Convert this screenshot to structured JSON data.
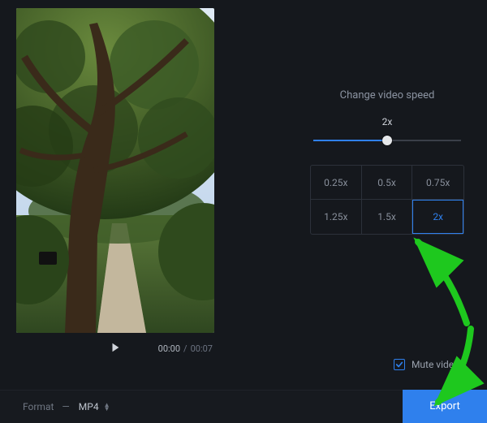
{
  "preview": {
    "current_time": "00:00",
    "duration": "00:07"
  },
  "settings": {
    "title": "Change video speed",
    "current_speed_label": "2x",
    "slider_percent": 50,
    "speeds": [
      "0.25x",
      "0.5x",
      "0.75x",
      "1.25x",
      "1.5x",
      "2x"
    ],
    "selected_speed_index": 5,
    "mute_label": "Mute video",
    "mute_checked": true
  },
  "bottom": {
    "format_label": "Format",
    "format_value": "MP4",
    "export_label": "Export"
  },
  "colors": {
    "accent": "#2f80ed",
    "annotation": "#1ec81e"
  }
}
